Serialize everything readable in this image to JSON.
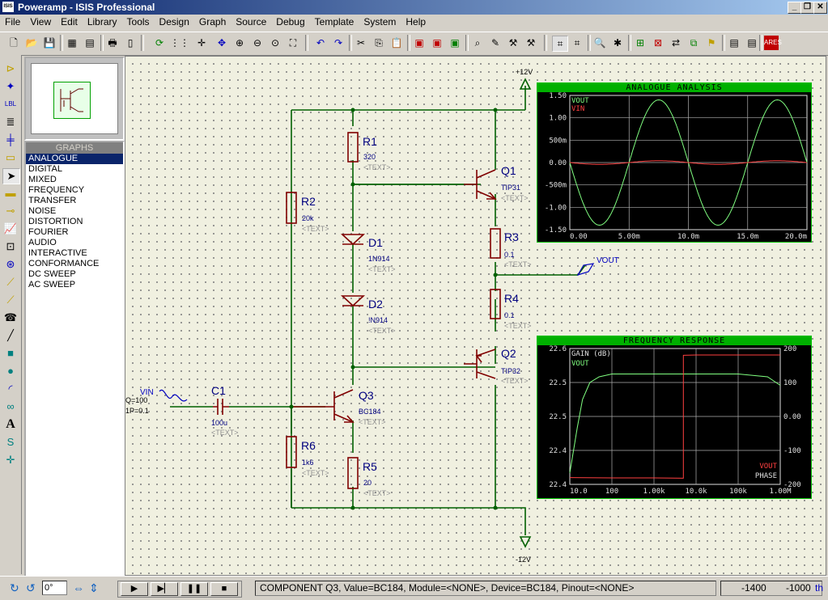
{
  "window": {
    "title": "Poweramp - ISIS Professional",
    "app_icon_text": "ISIS"
  },
  "menu": [
    "File",
    "View",
    "Edit",
    "Library",
    "Tools",
    "Design",
    "Graph",
    "Source",
    "Debug",
    "Template",
    "System",
    "Help"
  ],
  "overview": {},
  "graphs_panel": {
    "header": "GRAPHS",
    "items": [
      "ANALOGUE",
      "DIGITAL",
      "MIXED",
      "FREQUENCY",
      "TRANSFER",
      "NOISE",
      "DISTORTION",
      "FOURIER",
      "AUDIO",
      "INTERACTIVE",
      "CONFORMANCE",
      "DC SWEEP",
      "AC SWEEP"
    ],
    "selected": "ANALOGUE"
  },
  "schematic": {
    "rails": {
      "positive": "+12V",
      "negative": "-12V"
    },
    "components": [
      {
        "ref": "R1",
        "value": "320",
        "text": "<TEXT>"
      },
      {
        "ref": "R2",
        "value": "20k",
        "text": "<TEXT>"
      },
      {
        "ref": "D1",
        "value": "1N914",
        "text": "<TEXT>"
      },
      {
        "ref": "D2",
        "value": "!N914",
        "text": "<TEXT>"
      },
      {
        "ref": "Q1",
        "value": "TIP31",
        "text": "<TEXT>"
      },
      {
        "ref": "R3",
        "value": "0.1",
        "text": "<TEXT>"
      },
      {
        "ref": "R4",
        "value": "0.1",
        "text": "<TEXT>"
      },
      {
        "ref": "Q2",
        "value": "TIP32",
        "text": "<TEXT>"
      },
      {
        "ref": "Q3",
        "value": "BC184",
        "text": "<TEXT>"
      },
      {
        "ref": "R5",
        "value": "20",
        "text": "<TEXT>"
      },
      {
        "ref": "R6",
        "value": "1k6",
        "text": "<TEXT>"
      },
      {
        "ref": "C1",
        "value": "100u",
        "text": "<TEXT>"
      }
    ],
    "source": {
      "name": "VIN",
      "line1": "Q=100",
      "line2": "1P=0.1"
    },
    "probe": "VOUT"
  },
  "analogue_graph": {
    "title": "ANALOGUE ANALYSIS",
    "traces": [
      {
        "name": "VOUT",
        "color": "#80ff80"
      },
      {
        "name": "VIN",
        "color": "#ff4040"
      }
    ],
    "y_ticks": [
      "1.50",
      "1.00",
      "500m",
      "0.00",
      "-500m",
      "-1.00",
      "-1.50"
    ],
    "x_ticks": [
      "0.00",
      "5.00m",
      "10.0m",
      "15.0m",
      "20.0m"
    ]
  },
  "frequency_graph": {
    "title": "FREQUENCY RESPONSE",
    "left_axis_label": "GAIN (dB)",
    "left_trace": "VOUT",
    "right_legend": [
      "VOUT",
      "PHASE"
    ],
    "y_left_ticks": [
      "22.6",
      "22.5",
      "22.5",
      "22.4",
      "22.4"
    ],
    "y_right_ticks": [
      "200",
      "100",
      "0.00",
      "-100",
      "-200"
    ],
    "x_ticks": [
      "10.0",
      "100",
      "1.00k",
      "10.0k",
      "100k",
      "1.00M"
    ]
  },
  "chart_data": [
    {
      "type": "line",
      "title": "ANALOGUE ANALYSIS",
      "xlabel": "",
      "ylabel": "",
      "xlim": [
        0,
        0.02
      ],
      "ylim": [
        -1.5,
        1.5
      ],
      "x": [
        0,
        0.001,
        0.002,
        0.003,
        0.004,
        0.005,
        0.006,
        0.007,
        0.008,
        0.009,
        0.01,
        0.011,
        0.012,
        0.013,
        0.014,
        0.015,
        0.016,
        0.017,
        0.018,
        0.019,
        0.02
      ],
      "series": [
        {
          "name": "VOUT",
          "color": "#80ff80",
          "values": [
            0.0,
            -0.8,
            -1.3,
            -1.25,
            -0.75,
            0.0,
            0.75,
            1.25,
            1.4,
            0.8,
            0.0,
            -0.8,
            -1.3,
            -1.25,
            -0.75,
            0.0,
            0.75,
            1.25,
            1.4,
            0.8,
            0.0
          ]
        },
        {
          "name": "VIN",
          "color": "#ff4040",
          "values": [
            0.0,
            -0.02,
            -0.04,
            -0.03,
            -0.02,
            0.0,
            0.02,
            0.03,
            0.04,
            0.02,
            0.0,
            -0.02,
            -0.04,
            -0.03,
            -0.02,
            0.0,
            0.02,
            0.03,
            0.04,
            0.02,
            0.0
          ]
        }
      ],
      "grid": true
    },
    {
      "type": "line",
      "title": "FREQUENCY RESPONSE",
      "xlabel": "",
      "ylabel": "GAIN (dB)",
      "log_x": true,
      "xlim": [
        10,
        1000000
      ],
      "ylim_left": [
        22.38,
        22.62
      ],
      "ylim_right": [
        -200,
        200
      ],
      "series": [
        {
          "name": "VOUT",
          "axis": "left",
          "color": "#80ff80",
          "x": [
            10,
            15,
            20,
            30,
            50,
            100,
            1000,
            10000,
            100000,
            500000,
            1000000
          ],
          "values": [
            22.4,
            22.48,
            22.53,
            22.56,
            22.57,
            22.575,
            22.575,
            22.575,
            22.575,
            22.57,
            22.555
          ]
        },
        {
          "name": "PHASE",
          "axis": "right",
          "color": "#ff4040",
          "x": [
            10,
            100,
            1000,
            5000,
            5000.1,
            10000,
            100000,
            1000000
          ],
          "values": [
            -180,
            -181,
            -181,
            -182,
            180,
            181,
            181,
            181
          ]
        }
      ],
      "grid": true
    }
  ],
  "status": {
    "angle": "0°",
    "message": "COMPONENT Q3, Value=BC184, Module=<NONE>, Device=BC184, Pinout=<NONE>",
    "x": "-1400",
    "y": "-1000",
    "units": "th"
  }
}
